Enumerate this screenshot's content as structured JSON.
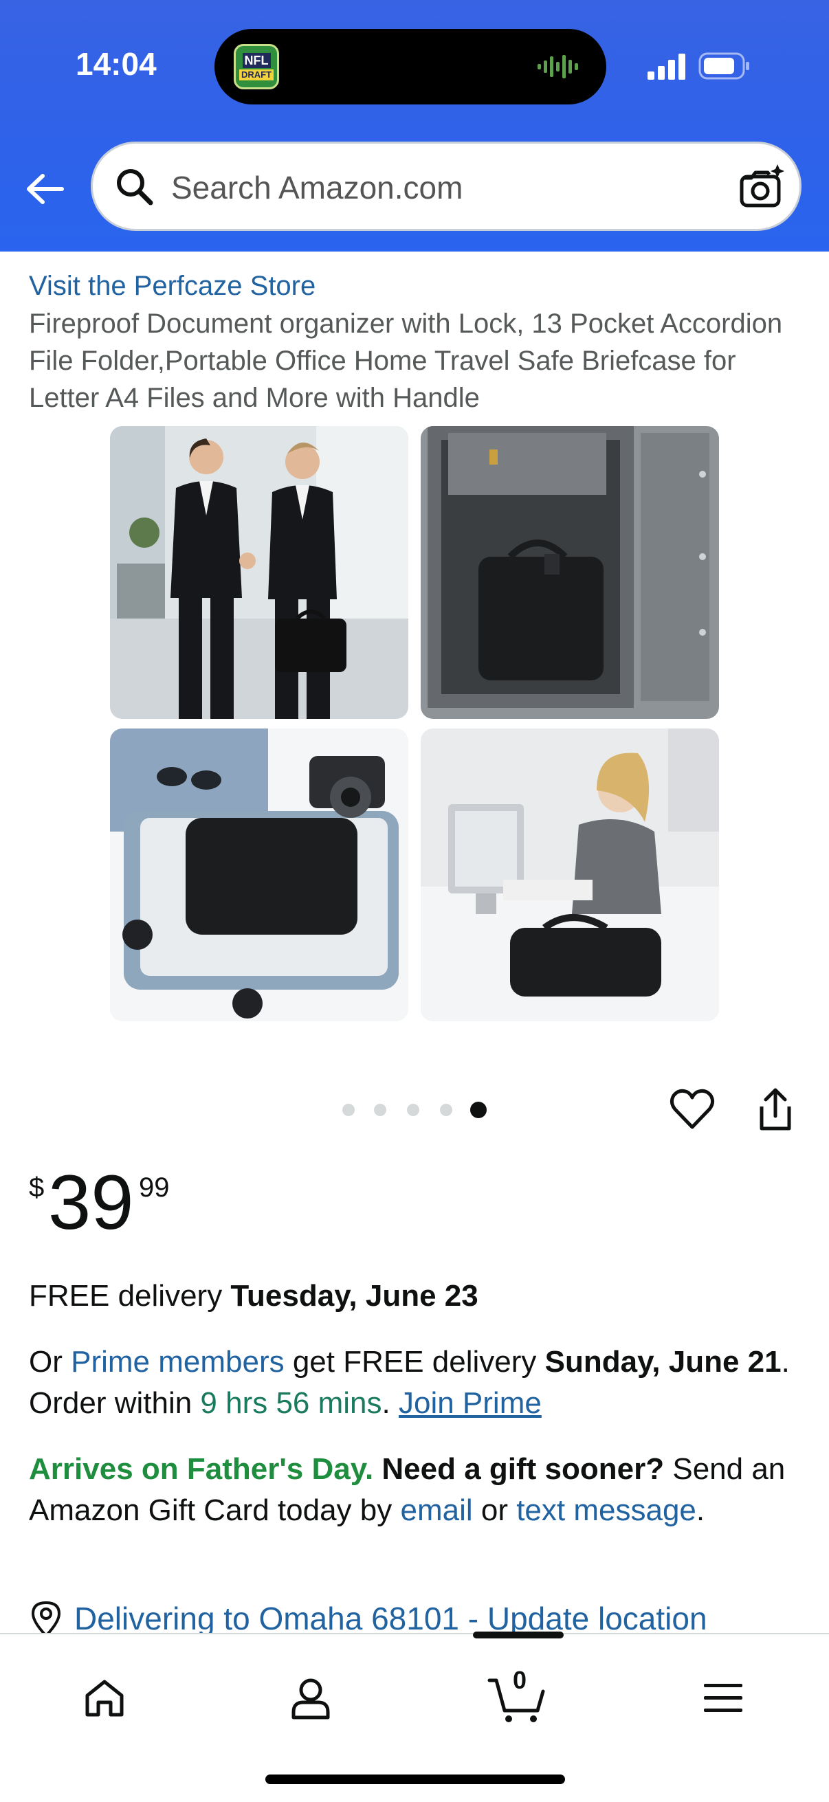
{
  "status_bar": {
    "time": "14:04",
    "live_activity_badge": [
      "NFL",
      "DRAFT"
    ]
  },
  "header": {
    "search_placeholder": "Search Amazon.com"
  },
  "product": {
    "store_link": "Visit the Perfcaze Store",
    "title": "Fireproof Document organizer with Lock, 13 Pocket Accordion File Folder,Portable Office Home Travel Safe Briefcase for Letter A4 Files and More with Handle",
    "gallery": {
      "images": [
        "two businessmen shaking hands, one holding black briefcase",
        "black document case inside open steel safe",
        "black document case in open suitcase with sunglasses and camera",
        "woman at desk with computer and black document case"
      ],
      "page_count": 5,
      "active_index": 4
    },
    "price": {
      "currency_symbol": "$",
      "whole": "39",
      "fraction": "99"
    }
  },
  "delivery": {
    "free_prefix": "FREE delivery ",
    "free_date": "Tuesday, June 23",
    "prime_or": "Or ",
    "prime_members": "Prime members",
    "prime_mid": " get FREE delivery ",
    "prime_date": "Sunday, June 21",
    "order_within_prefix": ". Order within ",
    "countdown": "9 hrs 56 mins",
    "period": ". ",
    "join_prime": "Join Prime",
    "fathers_day": "Arrives on Father's Day.",
    "gift_question": " Need a gift sooner?",
    "gift_text": " Send an Amazon Gift Card today by ",
    "email_link": "email",
    "or_text": " or ",
    "text_message_link": "text message",
    "end_period": "."
  },
  "location": {
    "text": "Delivering to Omaha 68101 - Update location"
  },
  "bottom_nav": {
    "cart_count": "0",
    "items": [
      "home-icon",
      "account-icon",
      "cart-icon",
      "menu-icon"
    ]
  },
  "colors": {
    "header_blue": "#2e62ea",
    "link_blue": "#2162a1",
    "teal": "#197a5d",
    "green": "#1e8e3e"
  }
}
